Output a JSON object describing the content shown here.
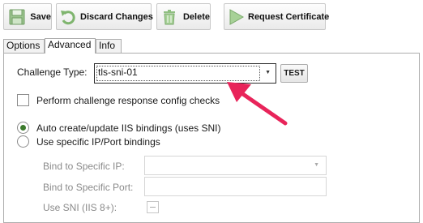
{
  "toolbar": {
    "save_label": "Save",
    "discard_label": "Discard Changes",
    "delete_label": "Delete",
    "request_label": "Request Certificate"
  },
  "tabs": [
    {
      "label": "Options"
    },
    {
      "label": "Advanced"
    },
    {
      "label": "Info"
    }
  ],
  "advanced": {
    "challenge_type_label": "Challenge Type:",
    "challenge_type_value": "tls-sni-01",
    "test_label": "TEST",
    "perform_checks_label": "Perform challenge response config checks",
    "auto_bindings_label": "Auto create/update IIS bindings (uses SNI)",
    "specific_bindings_label": "Use specific IP/Port bindings",
    "bind_ip_label": "Bind to Specific IP:",
    "bind_port_label": "Bind to Specific Port:",
    "use_sni_label": "Use SNI (IIS 8+):",
    "perform_checks_checked": false,
    "auto_bindings_selected": true,
    "specific_bindings_selected": false
  },
  "colors": {
    "arrow": "#e8245a",
    "radio_selected": "#3c7a2c"
  }
}
